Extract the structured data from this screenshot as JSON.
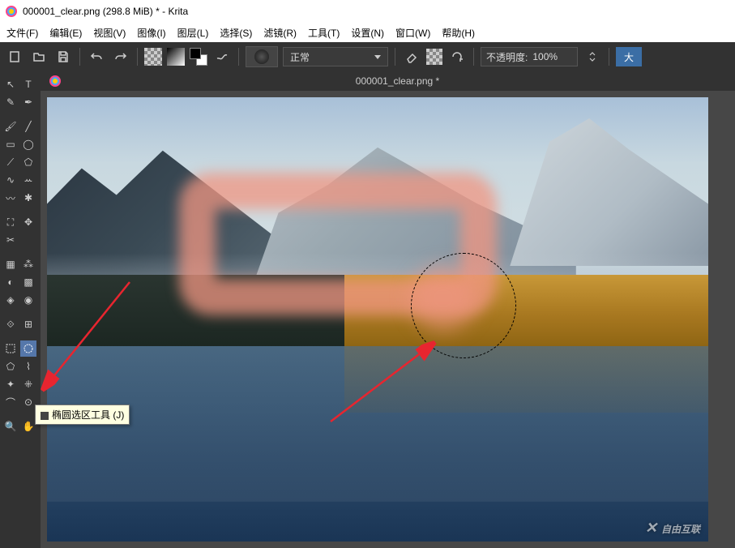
{
  "title": "000001_clear.png (298.8 MiB)  * - Krita",
  "menu": {
    "file": "文件(F)",
    "edit": "编辑(E)",
    "view": "视图(V)",
    "image": "图像(I)",
    "layer": "图层(L)",
    "select": "选择(S)",
    "filter": "滤镜(R)",
    "tools": "工具(T)",
    "settings": "设置(N)",
    "window": "窗口(W)",
    "help": "帮助(H)"
  },
  "toolbar": {
    "blend_mode": "正常",
    "opacity_label": "不透明度:",
    "opacity_value": "100%",
    "big_btn": "大"
  },
  "tab": {
    "title": "000001_clear.png *"
  },
  "tooltip": {
    "ellipse": "椭圆选区工具 (J)"
  },
  "watermark": "自由互联"
}
